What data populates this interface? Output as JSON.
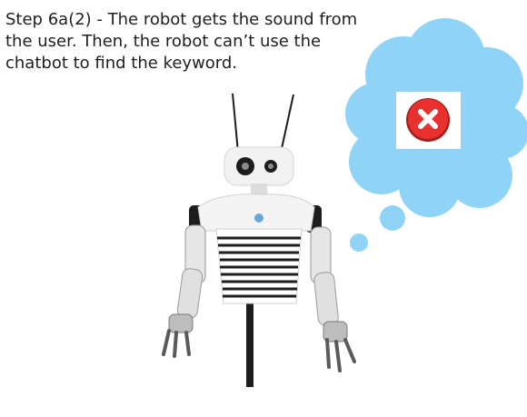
{
  "caption": {
    "lines": [
      "Step 6a(2) - The robot gets the sound from",
      "the user. Then, the robot can’t use the",
      "chatbot to find the keyword."
    ]
  },
  "colors": {
    "thought_cloud": "#8fd3f7",
    "error_red": "#e8312f",
    "robot_dark": "#1d1d1d",
    "robot_white": "#f4f4f4"
  },
  "icons": {
    "thought_cloud": "thought-cloud-icon",
    "status": "error-x-icon",
    "subject": "robot-icon"
  }
}
